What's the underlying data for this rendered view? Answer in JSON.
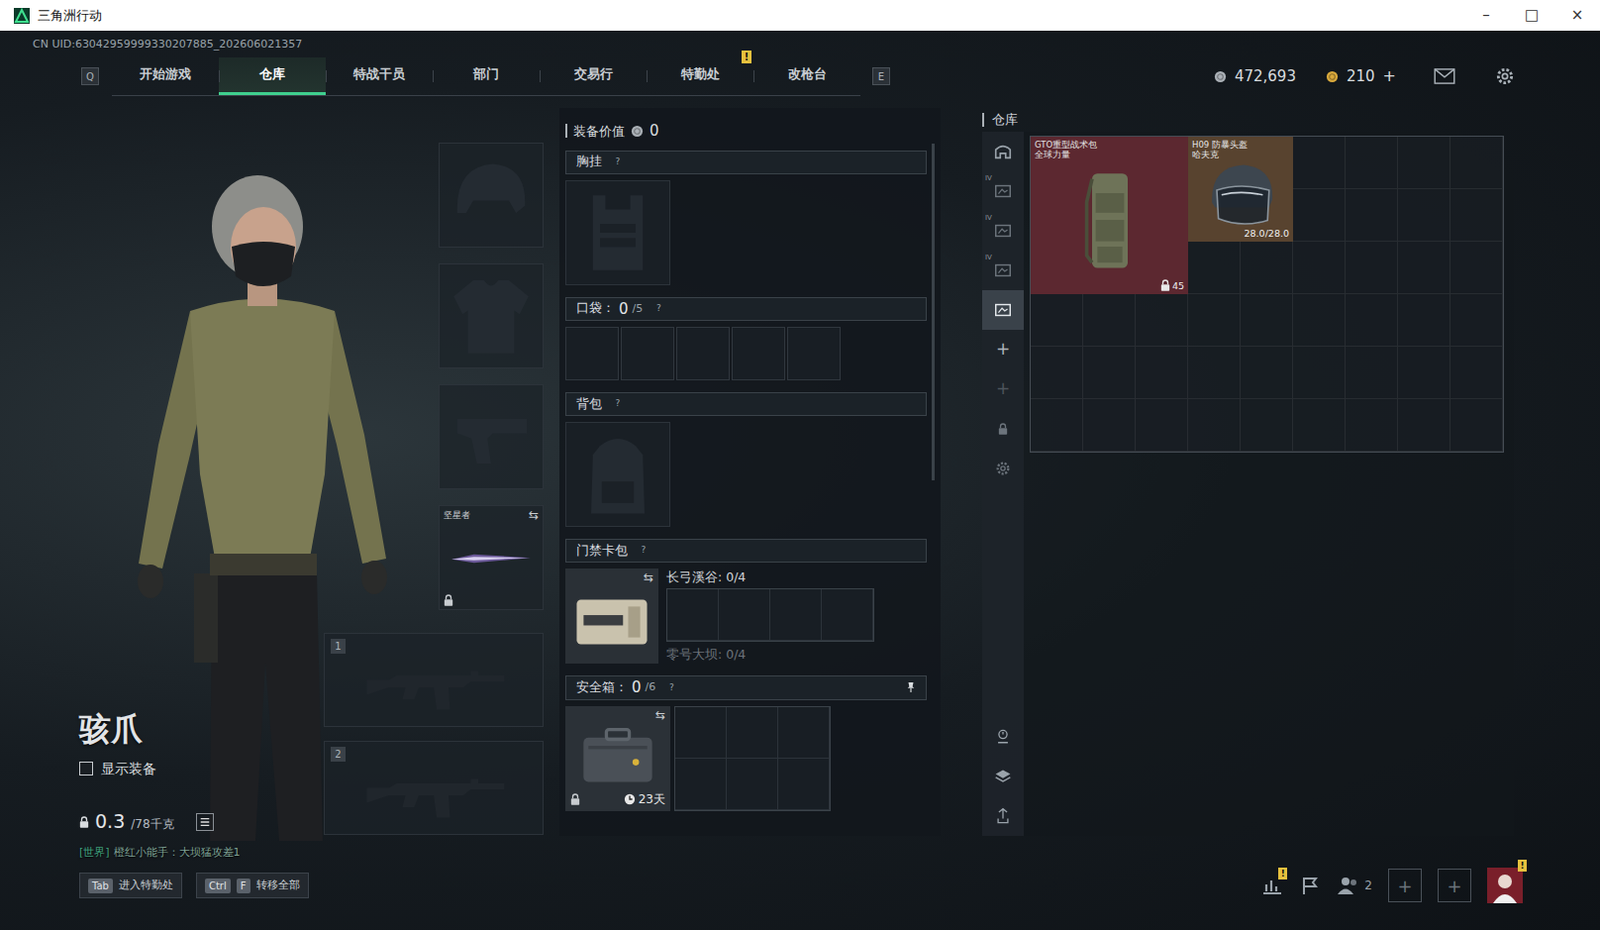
{
  "window": {
    "title": "三角洲行动",
    "controls": [
      "–",
      "□",
      "×"
    ]
  },
  "alert_mark": "!",
  "help_mark": "?",
  "swap_mark": "⇆",
  "uid": "CN UID:63042959999330207885_202606021357",
  "nav": {
    "prev_key": "Q",
    "next_key": "E",
    "tabs": [
      {
        "label": "开始游戏",
        "selected": false,
        "alert": false
      },
      {
        "label": "仓库",
        "selected": true,
        "alert": false
      },
      {
        "label": "特战干员",
        "selected": false,
        "alert": false
      },
      {
        "label": "部门",
        "selected": false,
        "alert": false
      },
      {
        "label": "交易行",
        "selected": false,
        "alert": false
      },
      {
        "label": "特勤处",
        "selected": false,
        "alert": true
      },
      {
        "label": "改枪台",
        "selected": false,
        "alert": false
      }
    ]
  },
  "currency": [
    {
      "kind": "coin",
      "amount": "472,693"
    },
    {
      "kind": "bond",
      "amount": "210",
      "action": "+"
    }
  ],
  "operator": {
    "name": "骇爪",
    "show_gear": {
      "label": "显示装备",
      "checked": false
    },
    "weight": {
      "current": "0.3",
      "max": "/78千克"
    }
  },
  "chat": {
    "channel": "[世界]",
    "text": "橙红小能手：大坝猛攻差1"
  },
  "gear_slots": [
    {
      "kind": "helmet"
    },
    {
      "kind": "armor"
    },
    {
      "kind": "pistol"
    },
    {
      "kind": "melee",
      "label": "坚星者",
      "locked": true
    },
    {
      "kind": "primary",
      "number": "1"
    },
    {
      "kind": "primary",
      "number": "2"
    }
  ],
  "loadout": {
    "value_label": "装备价值",
    "value": "0",
    "sections": [
      {
        "kind": "chest",
        "label": "胸挂"
      },
      {
        "kind": "pockets",
        "label": "口袋：",
        "used": "0",
        "capacity": "/5"
      },
      {
        "kind": "backpack",
        "label": "背包"
      },
      {
        "kind": "keycards",
        "label": "门禁卡包",
        "maps": [
          {
            "name": "长弓溪谷: 0/4",
            "faded": false,
            "expanded": true
          },
          {
            "name": "零号大坝: 0/4",
            "faded": true,
            "expanded": false
          }
        ]
      },
      {
        "kind": "safe",
        "label": "安全箱：",
        "used": "0",
        "capacity": "/6",
        "timer": "23天",
        "locked": true,
        "pinned": true
      }
    ]
  },
  "warehouse": {
    "title": "仓库",
    "side_tabs": [
      {
        "kind": "all",
        "selected": false
      },
      {
        "kind": "page",
        "tag": "IV",
        "selected": false
      },
      {
        "kind": "page",
        "tag": "IV",
        "selected": false
      },
      {
        "kind": "page",
        "tag": "IV",
        "selected": false
      },
      {
        "kind": "gallery",
        "selected": true
      },
      {
        "kind": "add",
        "label": "+",
        "disabled": false,
        "selected": false
      },
      {
        "kind": "add",
        "label": "+",
        "disabled": true,
        "selected": false
      },
      {
        "kind": "locked",
        "selected": false
      },
      {
        "kind": "settings",
        "selected": false
      }
    ],
    "tools": [
      {
        "kind": "sort"
      },
      {
        "kind": "layers"
      },
      {
        "kind": "recycle"
      }
    ],
    "items": [
      {
        "kind": "backpack",
        "name": "GTO重型战术包",
        "brand": "全球力量",
        "badge": "45",
        "locked": true,
        "color": "#5c2830"
      },
      {
        "kind": "helmet",
        "name": "H09 防暴头盔",
        "brand": "哈夫克",
        "durability": "28.0/28.0",
        "color": "#58432f"
      }
    ]
  },
  "bottom_bar": {
    "shortcuts": [
      {
        "keys": [
          "Tab"
        ],
        "label": "进入特勤处"
      },
      {
        "keys": [
          "Ctrl",
          "F"
        ],
        "label": "转移全部"
      }
    ],
    "tray": [
      {
        "kind": "stats",
        "alert": true
      },
      {
        "kind": "flag",
        "alert": false
      },
      {
        "kind": "friends",
        "count": "2",
        "alert": false
      },
      {
        "kind": "empty-slot",
        "label": "+",
        "alert": false
      },
      {
        "kind": "empty-slot",
        "label": "+",
        "alert": false
      },
      {
        "kind": "avatar",
        "alert": true
      }
    ]
  }
}
